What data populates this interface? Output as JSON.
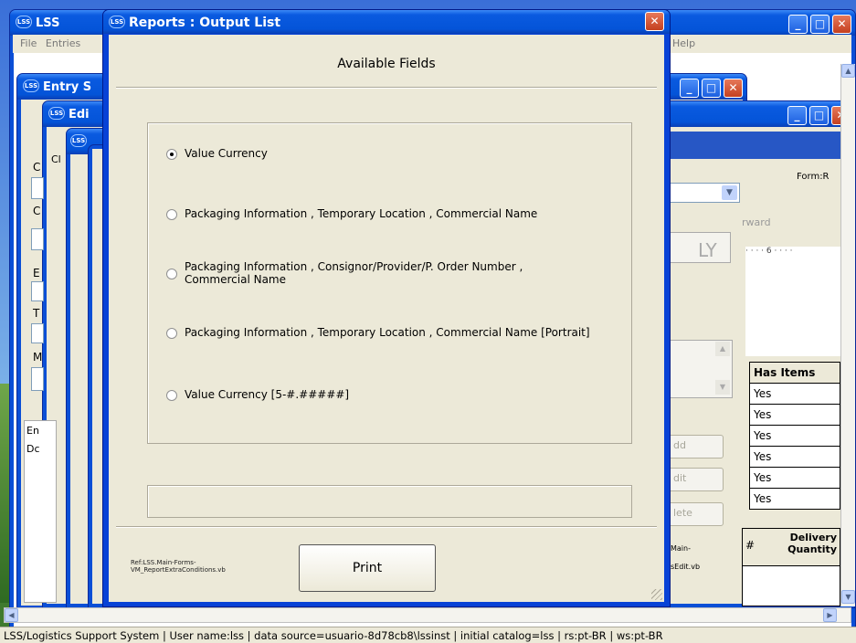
{
  "main_window": {
    "title": "LSS",
    "menu": [
      "File",
      "Entries",
      "Help"
    ]
  },
  "bg_windows": [
    {
      "title": "Entry S"
    },
    {
      "title": "Edi"
    }
  ],
  "right_panel": {
    "form_label": "Form:R",
    "forward_label": "rward",
    "ruler": "· · · · 6 · · · ·",
    "ly_text": "LY",
    "grid_header": "Has Items",
    "grid_rows": [
      "Yes",
      "Yes",
      "Yes",
      "Yes",
      "Yes",
      "Yes"
    ],
    "col_hash": "#",
    "col_delivery": "Delivery Quantity",
    "btn_add": "dd",
    "btn_edit": "dit",
    "btn_delete": "lete",
    "ref_main": "Main-",
    "ref_file": "sEdit.vb"
  },
  "left_labels": [
    "C",
    "C",
    "E",
    "T",
    "M",
    "En",
    "Dc",
    "Cl"
  ],
  "dialog": {
    "title": "Reports : Output List",
    "heading": "Available Fields",
    "options": [
      {
        "label": "Value Currency",
        "selected": true
      },
      {
        "label": "Packaging Information , Temporary Location , Commercial Name",
        "selected": false
      },
      {
        "label": "Packaging Information , Consignor/Provider/P. Order Number , Commercial Name",
        "selected": false
      },
      {
        "label": "Packaging Information , Temporary Location , Commercial Name  [Portrait]",
        "selected": false
      },
      {
        "label": "Value Currency [5-#.#####]",
        "selected": false
      }
    ],
    "ref_line1": "Ref:LSS.Main-Forms-",
    "ref_line2": "VM_ReportExtraConditions.vb",
    "print_label": "Print"
  },
  "status_bar": "LSS/Logistics Support System | User name:lss | data source=usuario-8d78cb8\\lssinst | initial catalog=lss | rs:pt-BR | ws:pt-BR",
  "colors": {
    "title_bar": "#0454d8",
    "dialog_face": "#ece9d8",
    "close_red": "#c4401f"
  }
}
